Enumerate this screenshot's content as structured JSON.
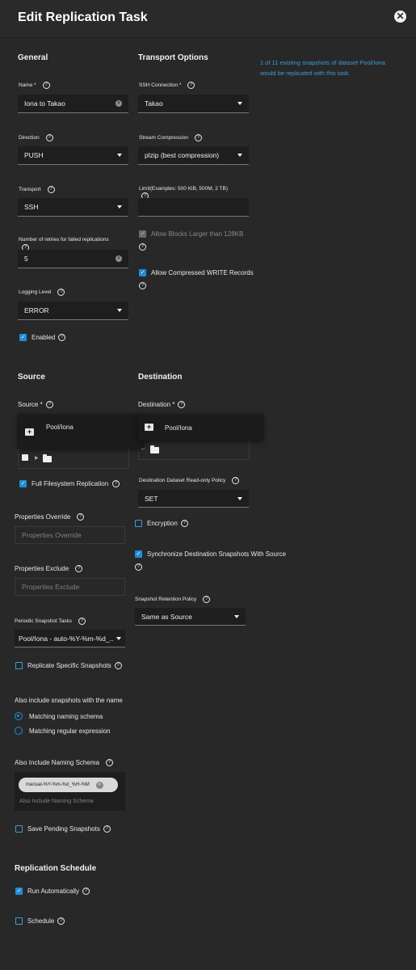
{
  "header": {
    "title": "Edit Replication Task",
    "close_icon": "close-icon"
  },
  "general": {
    "title": "General",
    "name": {
      "label": "Name *",
      "value": "Iona to Takao"
    },
    "direction": {
      "label": "Direction",
      "value": "PUSH"
    },
    "transport": {
      "label": "Transport",
      "value": "SSH"
    },
    "retries": {
      "label": "Number of retries for failed replications",
      "value": "5"
    },
    "logging": {
      "label": "Logging Level",
      "value": "ERROR"
    },
    "enabled": {
      "label": "Enabled",
      "checked": true
    }
  },
  "transport_options": {
    "title": "Transport Options",
    "ssh_connection": {
      "label": "SSH Connection *",
      "value": "Takao"
    },
    "stream_compression": {
      "label": "Stream Compression",
      "value": "plzip (best compression)"
    },
    "limit": {
      "label": "Limit(Examples: 500 KiB, 500M, 2 TB)",
      "value": ""
    },
    "allow_large_blocks": {
      "label": "Allow Blocks Larger than 128KB",
      "checked": true,
      "disabled": true
    },
    "allow_compressed": {
      "label": "Allow Compressed WRITE Records",
      "checked": true
    }
  },
  "info_text": "1 of 11 existing snapshots of dataset Pool/Iona would be replicated with this task.",
  "source": {
    "title": "Source",
    "label": "Source *",
    "popup_item": "Pool/Iona",
    "full_filesystem": {
      "label": "Full Filesystem Replication",
      "checked": true
    },
    "properties_override": {
      "label": "Properties Override",
      "placeholder": "Properties Override"
    },
    "properties_exclude": {
      "label": "Properties Exclude",
      "placeholder": "Properties Exclude"
    },
    "periodic_tasks": {
      "label": "Periodic Snapshot Tasks",
      "value": "Pool/Iona - auto-%Y-%m-%d_..."
    },
    "replicate_specific": {
      "label": "Replicate Specific Snapshots",
      "checked": false
    },
    "also_include_label": "Also include snapshots with the name",
    "radio_schema": {
      "label": "Matching naming schema",
      "selected": true
    },
    "radio_regex": {
      "label": "Matching regular expression",
      "selected": false
    },
    "naming_schema": {
      "label": "Also Include Naming Schema",
      "chip": "manual-%Y-%m-%d_%H-%M",
      "placeholder": "Also Include Naming Schema"
    },
    "save_pending": {
      "label": "Save Pending Snapshots",
      "checked": false
    }
  },
  "destination": {
    "title": "Destination",
    "label": "Destination *",
    "popup_item": "Pool/Iona",
    "readonly_policy": {
      "label": "Destination Dataset Read-only Policy",
      "value": "SET"
    },
    "encryption": {
      "label": "Encryption",
      "checked": false
    },
    "sync_snapshots": {
      "label": "Synchronize Destination Snapshots With Source",
      "checked": true
    },
    "retention": {
      "label": "Snapshot Retention Policy",
      "value": "Same as Source"
    }
  },
  "schedule": {
    "title": "Replication Schedule",
    "run_auto": {
      "label": "Run Automatically",
      "checked": true
    },
    "schedule": {
      "label": "Schedule",
      "checked": false
    }
  },
  "colors": {
    "background": "#282828",
    "accent": "#1f8dd6",
    "info": "#3c9dd6"
  }
}
